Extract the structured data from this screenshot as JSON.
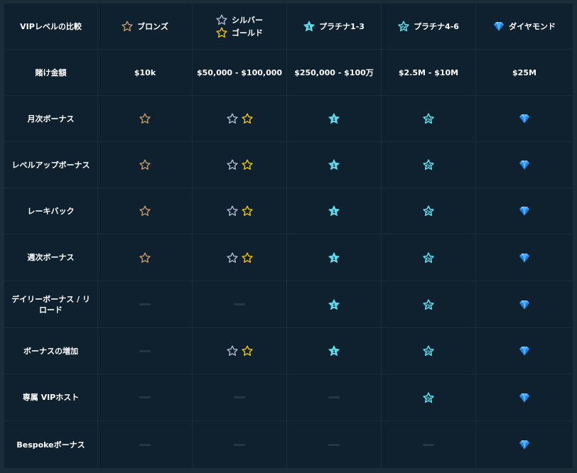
{
  "colors": {
    "background": "#0f212e",
    "grid_line": "#1a2c38",
    "bronze": "#c69a6b",
    "silver": "#b1bad3",
    "gold": "#f2c31b",
    "platinum": "#5fd8e9",
    "diamond": "#3ba0ff",
    "dash": "#233744"
  },
  "header": {
    "first": "VIPレベルの比較",
    "tiers": [
      {
        "label": "ブロンズ",
        "icon": "bronze-star-icon"
      },
      {
        "label_top": "シルバー",
        "label_bottom": "ゴールド",
        "icon_top": "silver-star-icon",
        "icon_bottom": "gold-star-icon"
      },
      {
        "label": "プラチナ1-3",
        "icon": "platinum-star-icon"
      },
      {
        "label": "プラチナ4-6",
        "icon": "platinum-iv-star-icon"
      },
      {
        "label": "ダイヤモンド",
        "icon": "diamond-icon"
      }
    ]
  },
  "rows": [
    {
      "label": "賭け金額",
      "values": [
        "$10k",
        "$50,000 - $100,000",
        "$250,000 - $100万",
        "$2.5M - $10M",
        "$25M"
      ]
    },
    {
      "label": "月次ボーナス",
      "marks": [
        "bronze",
        "silver-gold",
        "platinum",
        "platinum-iv",
        "diamond"
      ]
    },
    {
      "label": "レベルアップボーナス",
      "marks": [
        "bronze",
        "silver-gold",
        "platinum",
        "platinum-iv",
        "diamond"
      ]
    },
    {
      "label": "レーキバック",
      "marks": [
        "bronze",
        "silver-gold",
        "platinum",
        "platinum-iv",
        "diamond"
      ]
    },
    {
      "label": "週次ボーナス",
      "marks": [
        "bronze",
        "silver-gold",
        "platinum",
        "platinum-iv",
        "diamond"
      ]
    },
    {
      "label": "デイリーボーナス / リロード",
      "marks": [
        "none",
        "none",
        "platinum",
        "platinum-iv",
        "diamond"
      ]
    },
    {
      "label": "ボーナスの増加",
      "marks": [
        "none",
        "silver-gold",
        "platinum",
        "platinum-iv",
        "diamond"
      ]
    },
    {
      "label": "専属 VIPホスト",
      "marks": [
        "none",
        "none",
        "none",
        "platinum-iv",
        "diamond"
      ]
    },
    {
      "label": "Bespokeボーナス",
      "marks": [
        "none",
        "none",
        "none",
        "none",
        "diamond"
      ]
    }
  ]
}
